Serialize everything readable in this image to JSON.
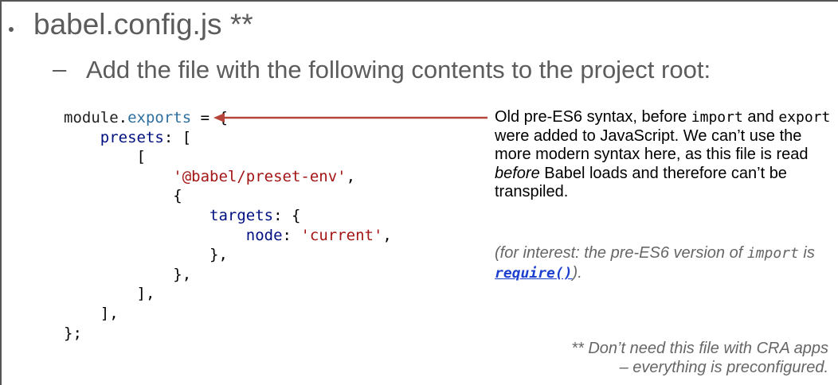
{
  "slide": {
    "heading": "babel.config.js **",
    "dash": "–",
    "subheading": "Add the file with the following contents to the project root:"
  },
  "code": {
    "line1_ident": "module",
    "line1_dot": ".",
    "line1_prop": "exports",
    "line1_rest": " = {",
    "line2_indent": "    ",
    "line2_key": "presets",
    "line2_rest": ": [",
    "line3": "        [",
    "line4_indent": "            ",
    "line4_str": "'@babel/preset-env'",
    "line4_rest": ",",
    "line5": "            {",
    "line6_indent": "                ",
    "line6_key": "targets",
    "line6_rest": ": {",
    "line7_indent": "                    ",
    "line7_key": "node",
    "line7_mid": ": ",
    "line7_str": "'current'",
    "line7_rest": ",",
    "line8": "                },",
    "line9": "            },",
    "line10": "        ],",
    "line11": "    ],",
    "line12": "};"
  },
  "note": {
    "p1_a": "Old pre-ES6 syntax, before ",
    "p1_code1": "import",
    "p1_b": " and ",
    "p1_code2": "export",
    "p1_c": " were added to JavaScript. We can’t use the more modern syntax here, as this file is read ",
    "p1_em": "before",
    "p1_d": " Babel loads and therefore can’t be transpiled.",
    "p2_a": "(for interest: the pre-ES6 version of ",
    "p2_code": "import",
    "p2_b": " is ",
    "p2_link": "require()",
    "p2_c": ")."
  },
  "footnote": {
    "line1": "** Don’t need this file with CRA apps",
    "line2": "– everything is preconfigured."
  },
  "colors": {
    "arrow": "#b5453b",
    "link": "#1d3fcf",
    "string": "#a31515",
    "key": "#001080"
  }
}
